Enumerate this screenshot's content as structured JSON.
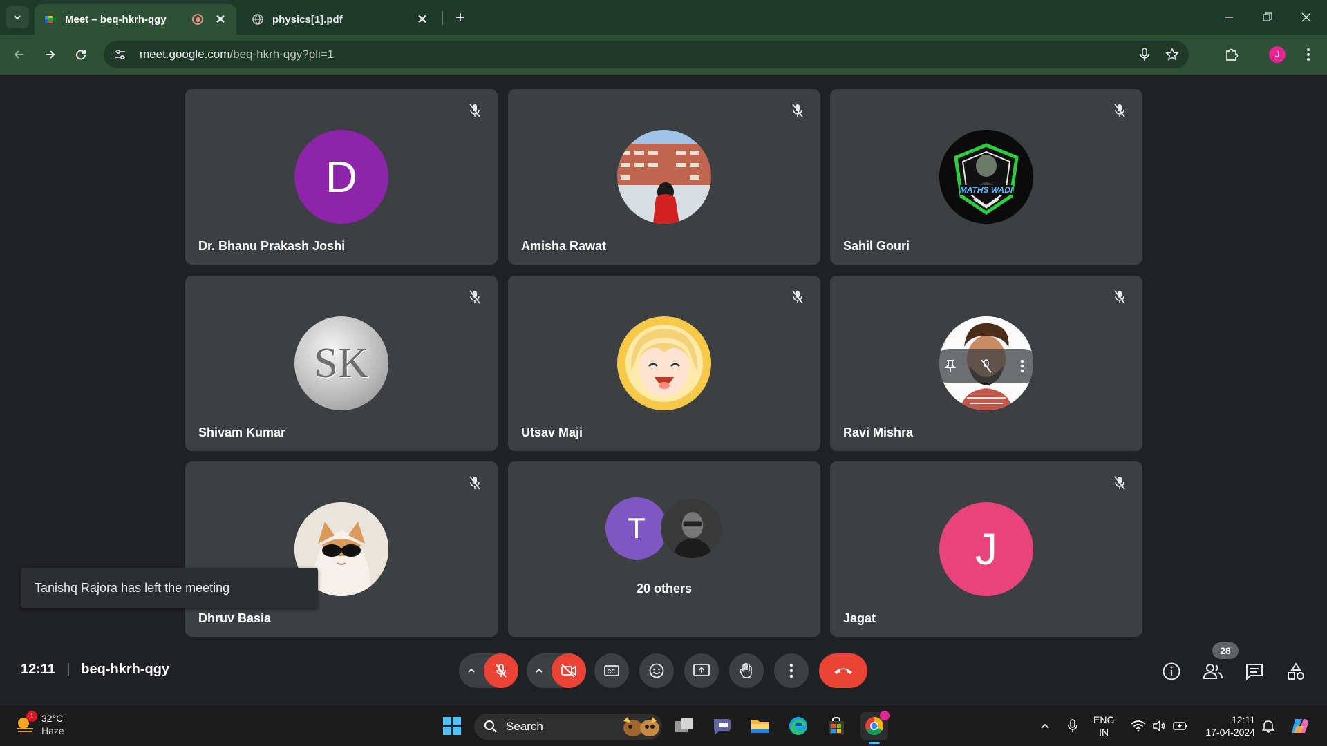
{
  "browser": {
    "tabs": [
      {
        "title": "Meet – beq-hkrh-qgy",
        "active": true
      },
      {
        "title": "physics[1].pdf",
        "active": false
      }
    ],
    "url_host": "meet.google.com",
    "url_path": "/beq-hkrh-qgy?pli=1",
    "profile_initial": "J"
  },
  "participants": [
    {
      "name": "Dr. Bhanu Prakash Joshi",
      "avatar_type": "letter",
      "letter": "D",
      "color": "#8e24aa"
    },
    {
      "name": "Amisha Rawat",
      "avatar_type": "photo"
    },
    {
      "name": "Sahil Gouri",
      "avatar_type": "logo",
      "logo_text": "MATHS WADI"
    },
    {
      "name": "Shivam Kumar",
      "avatar_type": "logo",
      "logo_text": "SK"
    },
    {
      "name": "Utsav Maji",
      "avatar_type": "illustration"
    },
    {
      "name": "Ravi Mishra",
      "avatar_type": "photo"
    },
    {
      "name": "Dhruv Basia",
      "avatar_type": "photo"
    },
    {
      "name": "Jagat",
      "avatar_type": "letter",
      "letter": "J",
      "color": "#e8437b"
    }
  ],
  "others_tile": {
    "label": "20 others",
    "letter": "T",
    "color": "#7e57c2"
  },
  "toast": "Tanishq Rajora has left the meeting",
  "meeting": {
    "time": "12:11",
    "separator": "|",
    "code": "beq-hkrh-qgy"
  },
  "people_count": "28",
  "taskbar": {
    "weather_temp": "32°C",
    "weather_desc": "Haze",
    "weather_badge": "1",
    "search_label": "Search",
    "lang_line1": "ENG",
    "lang_line2": "IN",
    "time": "12:11",
    "date": "17-04-2024"
  },
  "colors": {
    "accent_red": "#ea4335",
    "tile_bg": "#3c4043",
    "stage_bg": "#202124",
    "browser_frame": "#2e5136"
  }
}
